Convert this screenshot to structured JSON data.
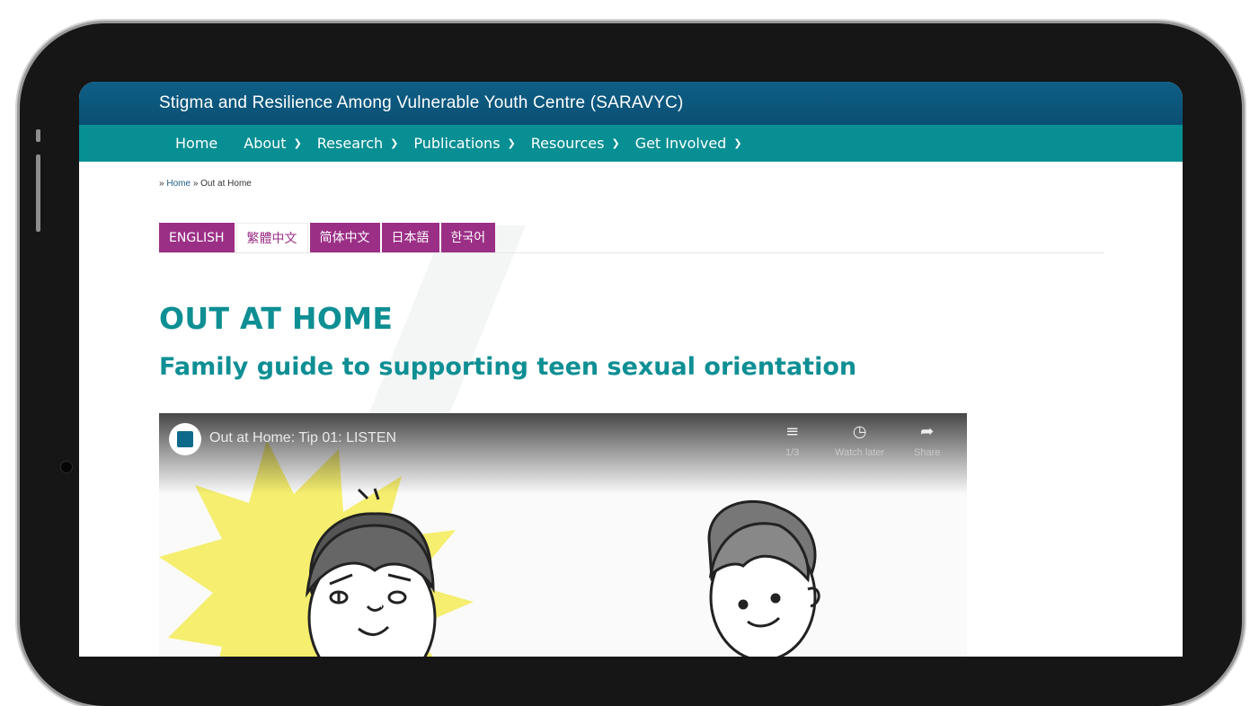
{
  "header": {
    "site_title": "Stigma and Resilience Among Vulnerable Youth Centre (SARAVYC)"
  },
  "nav": {
    "items": [
      {
        "label": "Home",
        "dropdown": false
      },
      {
        "label": "About",
        "dropdown": true
      },
      {
        "label": "Research",
        "dropdown": true
      },
      {
        "label": "Publications",
        "dropdown": true
      },
      {
        "label": "Resources",
        "dropdown": true
      },
      {
        "label": "Get Involved",
        "dropdown": true
      }
    ]
  },
  "breadcrumb": {
    "sep": "»",
    "home": "Home",
    "current": "Out at Home"
  },
  "languages": {
    "tabs": [
      "ENGLISH",
      "繁體中文",
      "简体中文",
      "日本語",
      "한국어"
    ],
    "active": "繁體中文"
  },
  "page": {
    "title": "OUT AT HOME",
    "subtitle": "Family guide to supporting teen sexual orientation"
  },
  "video": {
    "title": "Out at Home: Tip 01: LISTEN",
    "playlist_count": "1/3",
    "watch_later": "Watch later",
    "share": "Share"
  },
  "colors": {
    "header_blue": "#0a4f73",
    "nav_teal": "#078f93",
    "accent_purple": "#9b2f86",
    "title_teal": "#0e8f94",
    "starburst_yellow": "#f5ee6e"
  }
}
